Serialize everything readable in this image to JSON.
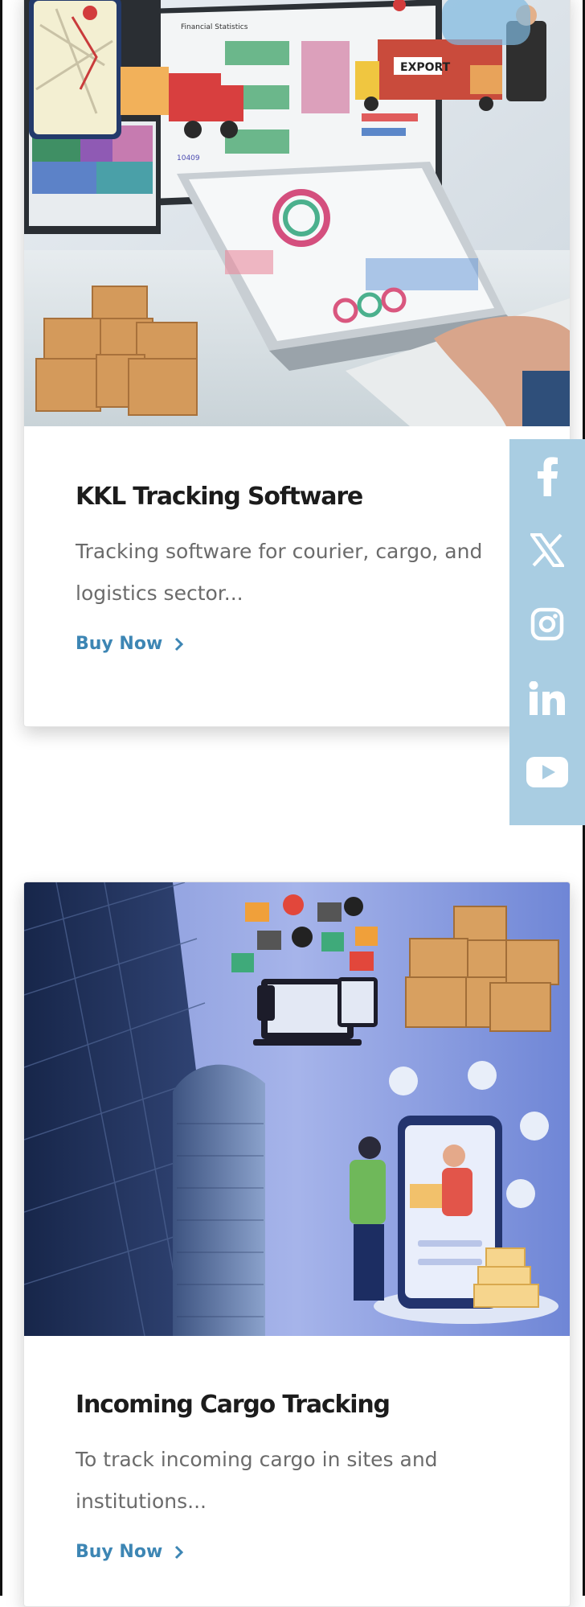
{
  "products": [
    {
      "title": "KKL Tracking Software",
      "description_line1": "Tracking software for courier, cargo, and",
      "description_line2": "logistics sector...",
      "cta_label": "Buy Now",
      "image_labels": {
        "export_sign": "EXPORT",
        "screen_heading": "Financial Statistics",
        "screen_number": "10409"
      }
    },
    {
      "title": "Incoming Cargo Tracking",
      "description_line1": "To track incoming cargo in sites and",
      "description_line2": "institutions...",
      "cta_label": "Buy Now"
    }
  ],
  "social_links": [
    {
      "name": "facebook",
      "icon": "facebook-icon"
    },
    {
      "name": "x",
      "icon": "x-icon"
    },
    {
      "name": "instagram",
      "icon": "instagram-icon"
    },
    {
      "name": "linkedin",
      "icon": "linkedin-icon"
    },
    {
      "name": "youtube",
      "icon": "youtube-icon"
    }
  ],
  "colors": {
    "link": "#3d86b4",
    "social_bar": "#a9cde2",
    "title": "#1c1c1c",
    "text": "#6b6b6b"
  }
}
